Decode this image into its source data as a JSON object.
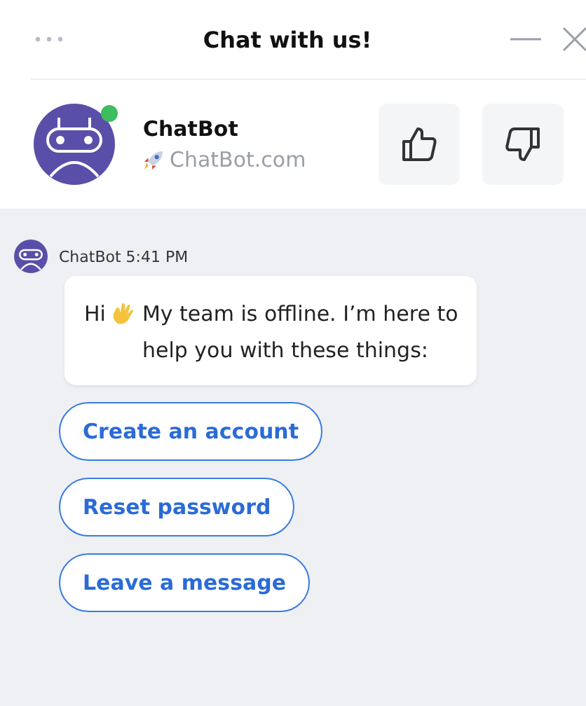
{
  "header": {
    "title": "Chat with us!"
  },
  "agent": {
    "name": "ChatBot",
    "online": true,
    "site": "ChatBot.com"
  },
  "message": {
    "sender": "ChatBot",
    "time": "5:41 PM",
    "greeting": "Hi",
    "text": "My team is offline. I’m here to help you with these things:"
  },
  "options": [
    "Create an account",
    "Reset password",
    "Leave a message"
  ]
}
